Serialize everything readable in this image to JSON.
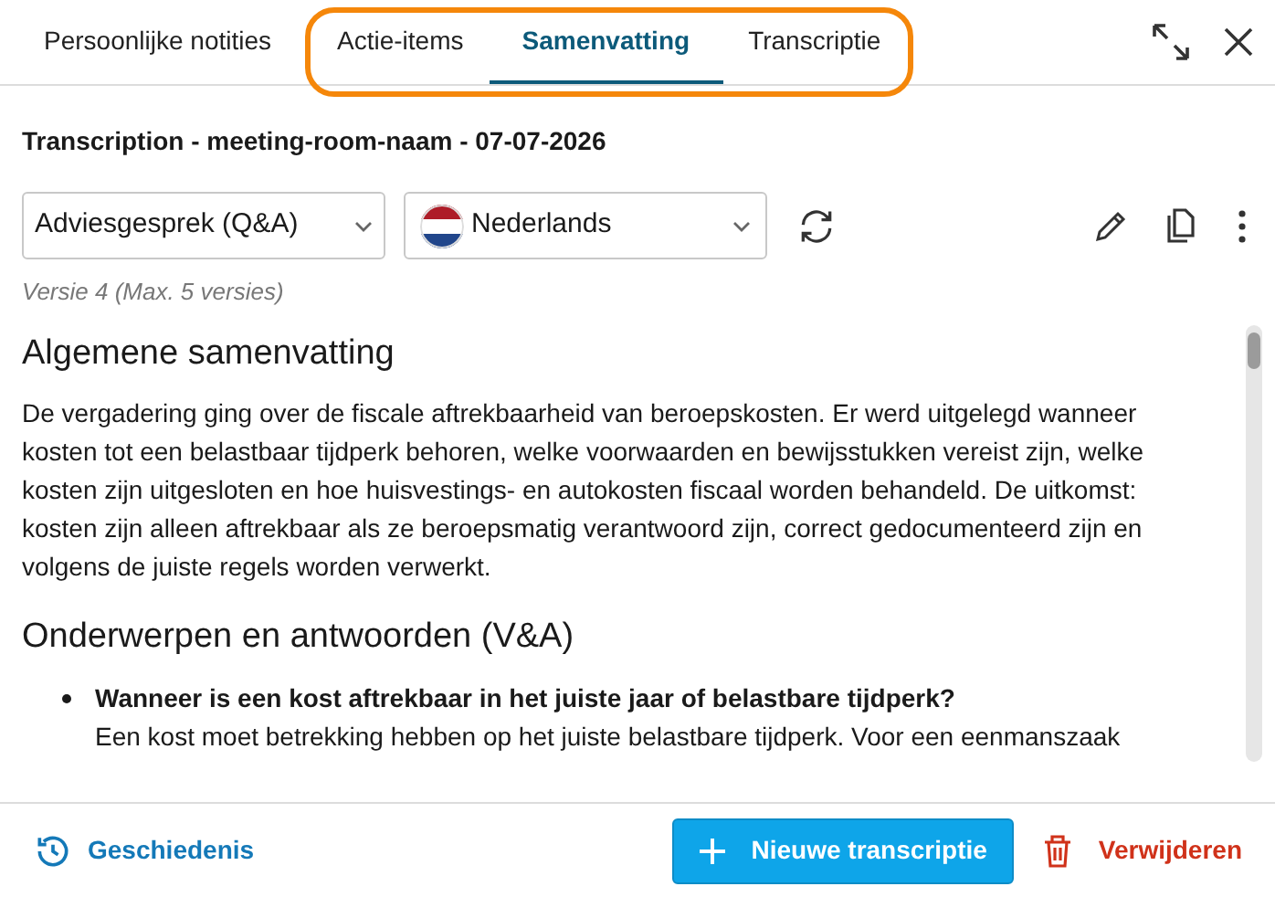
{
  "tabs": [
    {
      "label": "Persoonlijke notities",
      "selected": false,
      "highlighted": false
    },
    {
      "label": "Actie-items",
      "selected": false,
      "highlighted": true
    },
    {
      "label": "Samenvatting",
      "selected": true,
      "highlighted": true
    },
    {
      "label": "Transcriptie",
      "selected": false,
      "highlighted": true
    }
  ],
  "title": "Transcription - meeting-room-naam - 07-07-2026",
  "template_select": {
    "value": "Adviesgesprek (Q&A)"
  },
  "language_select": {
    "value": "Nederlands"
  },
  "version": "Versie 4 (Max. 5 versies)",
  "content": [
    {
      "kind": "heading",
      "text": "Algemene samenvatting"
    },
    {
      "kind": "paragraph",
      "text": "De vergadering ging over de fiscale aftrekbaarheid van beroepskosten. Er werd uitgelegd wanneer kosten tot een belastbaar tijdperk behoren, welke voorwaarden en bewijsstukken vereist zijn, welke kosten zijn uitgesloten en hoe huisvestings- en autokosten fiscaal worden behandeld. De uitkomst: kosten zijn alleen aftrekbaar als ze beroepsmatig verantwoord zijn, correct gedocumenteerd zijn en volgens de juiste regels worden verwerkt."
    },
    {
      "kind": "heading",
      "text": "Onderwerpen en antwoorden (V&A)"
    },
    {
      "kind": "bullet",
      "question": "Wanneer is een kost aftrekbaar in het juiste jaar of belastbare tijdperk?",
      "answer": "Een kost moet betrekking hebben op het juiste belastbare tijdperk. Voor een eenmanszaak"
    }
  ],
  "footer": {
    "history": "Geschiedenis",
    "new": "Nieuwe transcriptie",
    "delete": "Verwijderen"
  }
}
